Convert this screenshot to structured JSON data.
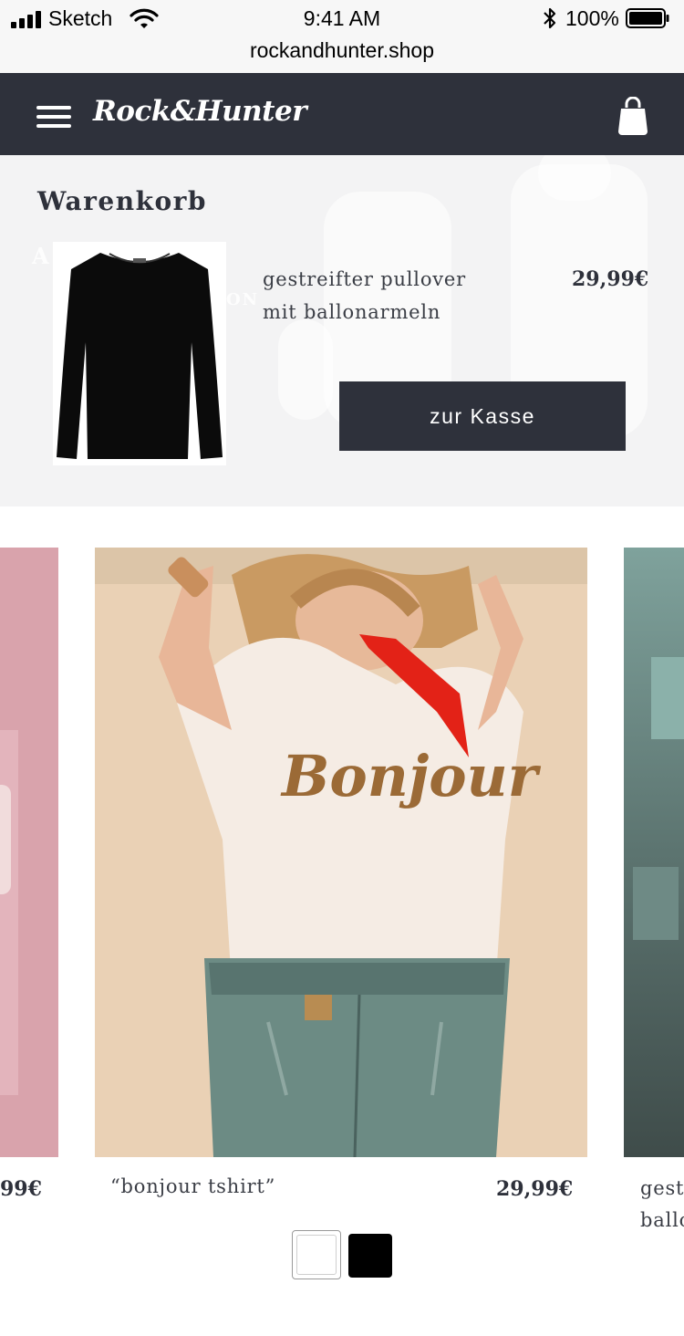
{
  "status_bar": {
    "carrier": "Sketch",
    "time": "9:41 AM",
    "battery": "100%",
    "url": "rockandhunter.shop"
  },
  "nav": {
    "logo": "Rock&Hunter",
    "menu_icon": "hamburger-icon",
    "bag_icon": "shopping-bag-icon"
  },
  "cart": {
    "title": "Warenkorb",
    "background_text": [
      "A          TARS",
      "ON"
    ],
    "item": {
      "name": "gestreifter pullover mit ballonarmeln",
      "price": "29,99€"
    },
    "checkout_label": "zur Kasse"
  },
  "products": [
    {
      "price": "99€"
    },
    {
      "name": "“bonjour tshirt”",
      "price": "29,99€",
      "print_text": "Bonjour"
    },
    {
      "name_line1": "gestr",
      "name_line2": "ballo"
    }
  ],
  "colors": {
    "dark": "#2e313b",
    "swatches": [
      "#ffffff",
      "#000000"
    ]
  }
}
